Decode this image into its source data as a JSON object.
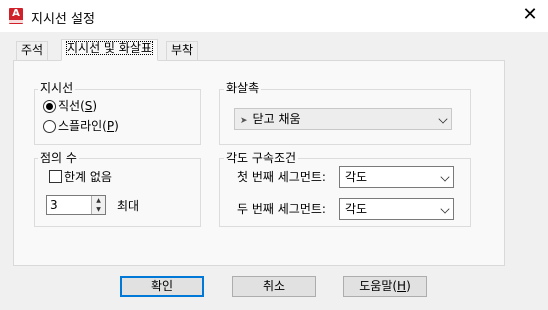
{
  "window": {
    "title": "지시선 설정",
    "close_glyph": "✕",
    "app_icon_letter": "A"
  },
  "tabs": [
    {
      "label": "주석"
    },
    {
      "label": "지시선 및 화살표"
    },
    {
      "label": "부착"
    }
  ],
  "leader": {
    "group_title": "지시선",
    "options": [
      {
        "prefix": "직선(",
        "mnemonic": "S",
        "suffix": ")",
        "checked": true
      },
      {
        "prefix": "스플라인(",
        "mnemonic": "P",
        "suffix": ")",
        "checked": false
      }
    ]
  },
  "arrowhead": {
    "group_title": "화살촉",
    "selected": "닫고 채움",
    "arrow_glyph": "➤"
  },
  "points": {
    "group_title": "점의 수",
    "unlimited_label": "한계 없음",
    "unlimited_checked": false,
    "value": "3",
    "max_label": "최대",
    "up_glyph": "▲",
    "down_glyph": "▼"
  },
  "angle": {
    "group_title": "각도 구속조건",
    "first_label": "첫 번째 세그먼트:",
    "first_value": "각도",
    "second_label": "두 번째 세그먼트:",
    "second_value": "각도"
  },
  "buttons": {
    "ok": {
      "prefix": "확인",
      "mnemonic": "",
      "suffix": ""
    },
    "cancel": "취소",
    "help": {
      "prefix": "도움말(",
      "mnemonic": "H",
      "suffix": ")"
    }
  }
}
